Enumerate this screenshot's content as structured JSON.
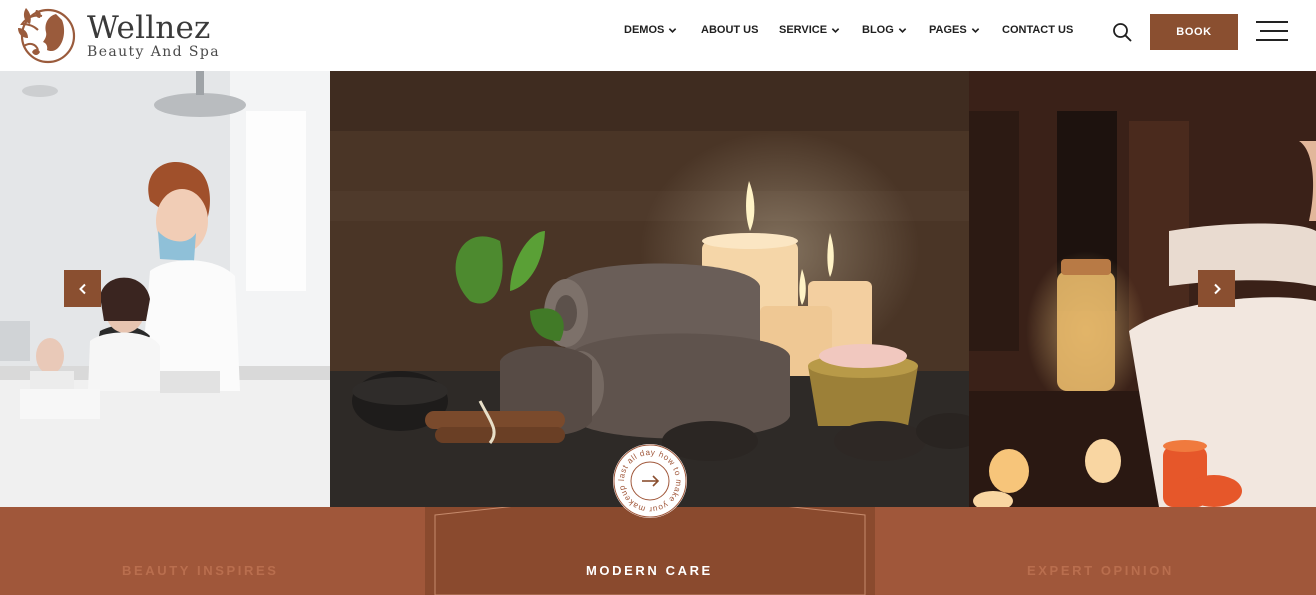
{
  "brand": {
    "name": "Wellnez",
    "tagline": "Beauty And Spa",
    "accent": "#8a4f30",
    "band_color": "#a0573a"
  },
  "nav": {
    "items": [
      {
        "label": "DEMOS",
        "dropdown": true
      },
      {
        "label": "ABOUT US",
        "dropdown": false
      },
      {
        "label": "SERVICE",
        "dropdown": true
      },
      {
        "label": "BLOG",
        "dropdown": true
      },
      {
        "label": "PAGES",
        "dropdown": true
      },
      {
        "label": "CONTACT US",
        "dropdown": false
      }
    ],
    "search_icon": "search-icon",
    "book_label": "BOOK",
    "menu_icon": "hamburger-menu-icon"
  },
  "hero": {
    "prev_icon": "chevron-left-icon",
    "next_icon": "chevron-right-icon",
    "badge_text": "last all day how to make your makeup",
    "badge_icon": "arrow-right-icon"
  },
  "band": {
    "left_label": "BEAUTY INSPIRES",
    "center_label": "MODERN CARE",
    "right_label": "EXPERT OPINION"
  }
}
